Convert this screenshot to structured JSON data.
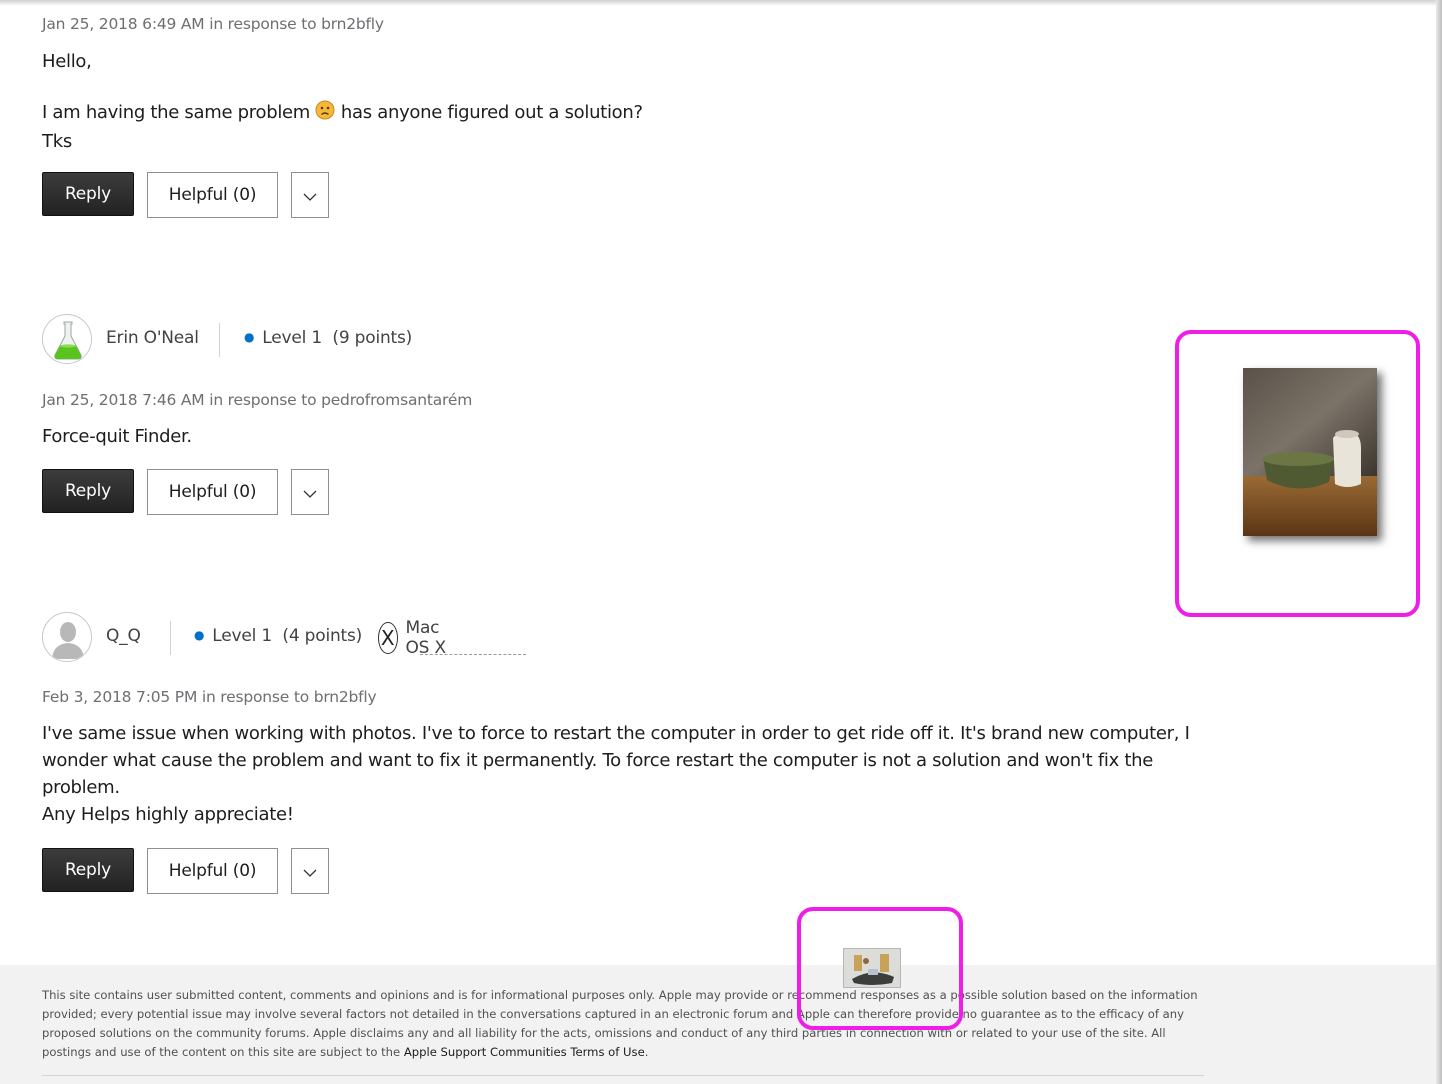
{
  "posts": [
    {
      "meta": "Jan 25, 2018 6:49 AM in response to brn2bfly",
      "body": {
        "line1": "Hello,",
        "line2a": "I am having the same problem",
        "line2b": "has anyone figured out a solution?",
        "line3": "Tks"
      },
      "reply_label": "Reply",
      "helpful_label": "Helpful (0)"
    },
    {
      "user": {
        "name": "Erin O'Neal",
        "level": "Level 1",
        "points": "(9 points)"
      },
      "meta": "Jan 25, 2018 7:46 AM in response to pedrofromsantarém",
      "body": {
        "line1": "Force-quit Finder."
      },
      "reply_label": "Reply",
      "helpful_label": "Helpful (0)"
    },
    {
      "user": {
        "name": "Q_Q",
        "level": "Level 1",
        "points": "(4 points)",
        "os": "Mac OS X"
      },
      "meta": "Feb 3, 2018 7:05 PM in response to brn2bfly",
      "body": {
        "line1": "I've same issue when working with photos. I've to force to restart the computer in order to get ride off it. It's brand new computer, I",
        "line2": "wonder what cause the problem and want to fix it  permanently. To force restart the computer is not a solution and won't fix the",
        "line3": "problem.",
        "line4": "Any Helps highly appreciate!"
      },
      "reply_label": "Reply",
      "helpful_label": "Helpful (0)"
    }
  ],
  "icons": {
    "frown": "frown-emoji-icon",
    "chevron": "chevron-down-icon",
    "os": "mac-os-x-icon",
    "avatar_flask": "flask-avatar-icon",
    "avatar_default": "default-user-avatar-icon"
  },
  "footer": {
    "disclaimer": "This site contains user submitted content, comments and opinions and is for informational purposes only. Apple may provide or recommend responses as a possible solution based on the information provided; every potential issue may involve several factors not detailed in the conversations captured in an electronic forum and Apple can therefore provide no guarantee as to the efficacy of any proposed solutions on the community forums. Apple disclaims any and all liability for the acts, omissions and conduct of any third parties in connection with or related to your use of the site. All postings and use of the content on this site are subject to the",
    "terms_link": "Apple Support Communities Terms of Use",
    "terms_suffix": "."
  },
  "colors": {
    "highlight": "#ee1ee8",
    "level_dot": "#0070c9",
    "reply_button": "#2a2a2a"
  }
}
